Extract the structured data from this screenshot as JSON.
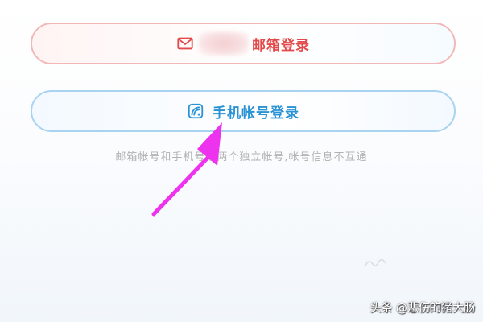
{
  "login": {
    "email_button_label": "邮箱登录",
    "phone_button_label": "手机帐号登录"
  },
  "hint": {
    "text": "邮箱帐号和手机号是两个独立帐号,帐号信息不互通"
  },
  "watermark": {
    "text": "头条 @悲伤的猪大肠"
  },
  "colors": {
    "email_accent": "#e34b4b",
    "phone_accent": "#2a93d5",
    "hint": "#b2b2b2",
    "annotation_arrow": "#ee33ee"
  },
  "icons": {
    "email": "envelope-icon",
    "phone": "phone-icon"
  }
}
